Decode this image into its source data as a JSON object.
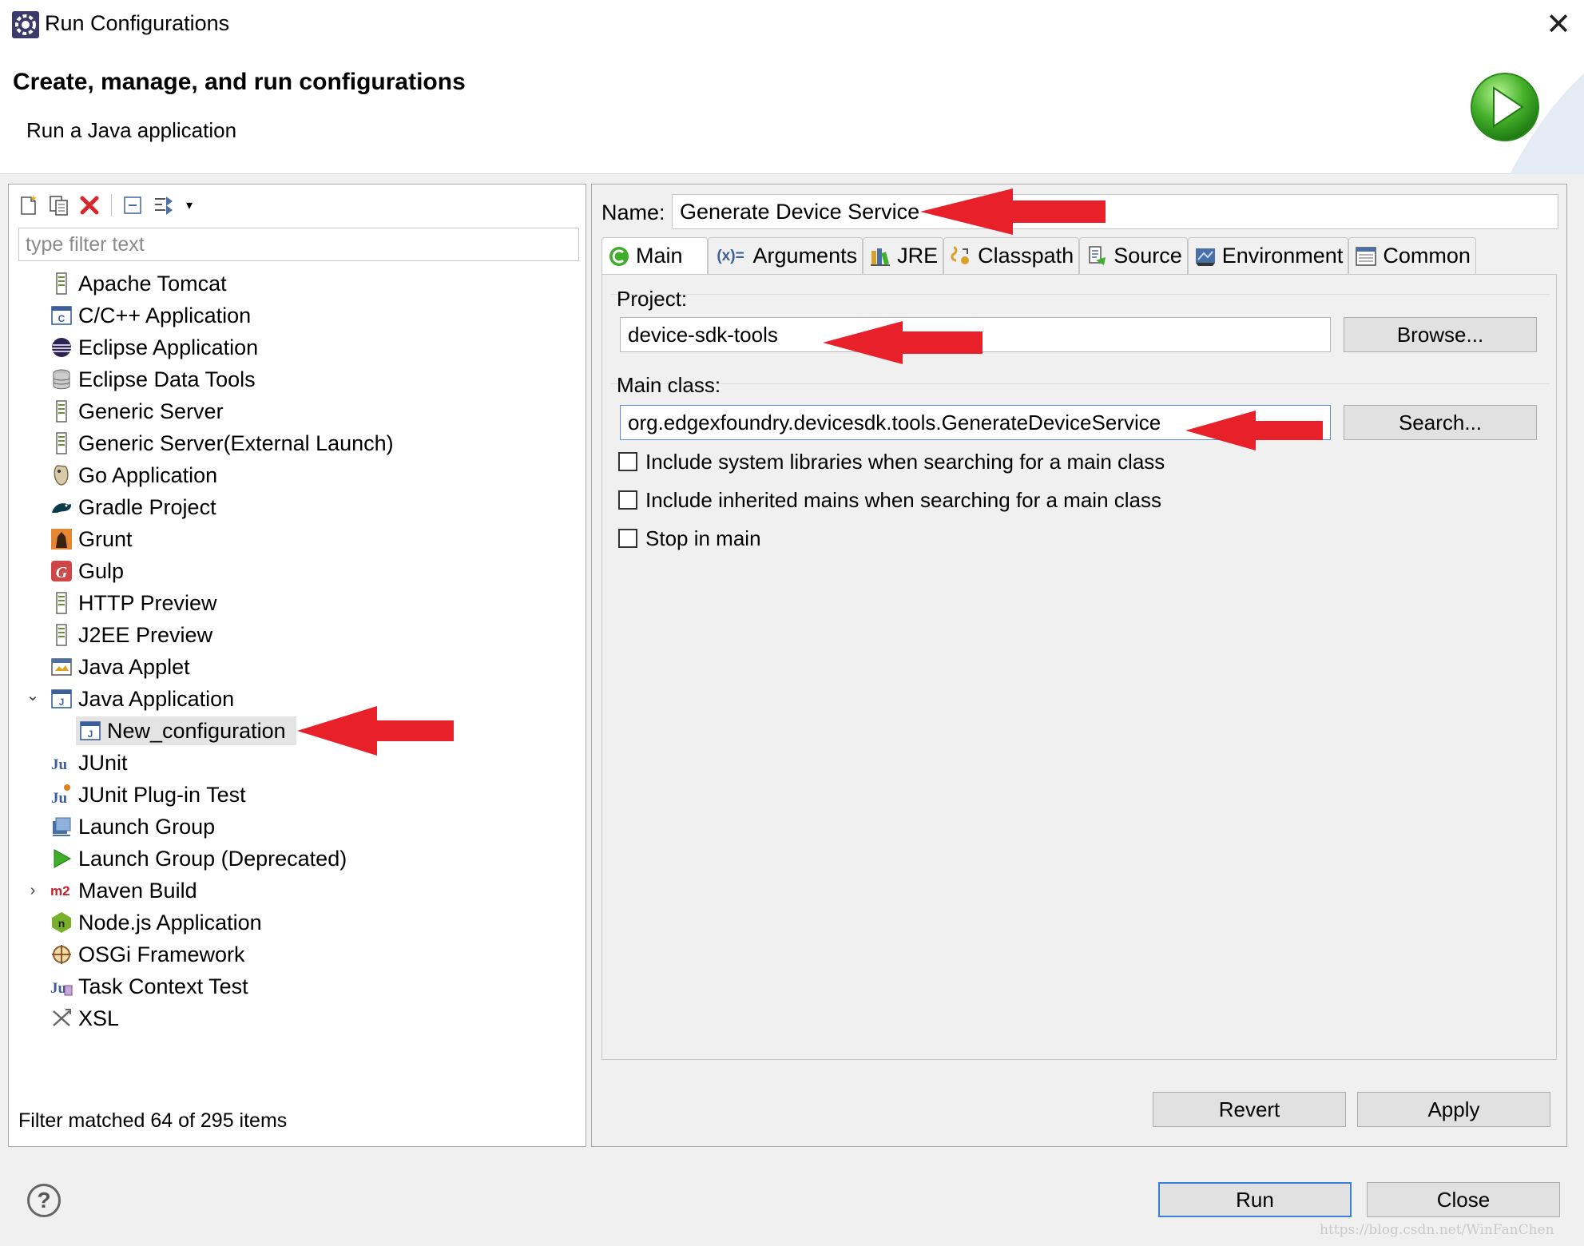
{
  "window": {
    "title": "Run Configurations",
    "close_glyph": "✕"
  },
  "banner": {
    "heading": "Create, manage, and run configurations",
    "subheading": "Run a Java application"
  },
  "left": {
    "toolbar": {
      "icons": [
        "new-launch-configuration-icon",
        "duplicate-icon",
        "delete-icon",
        "collapse-all-icon",
        "filter-icon",
        "dropdown-icon"
      ],
      "dropdown_glyph": "▾"
    },
    "filter_placeholder": "type filter text",
    "tree": [
      {
        "label": "Apache Tomcat",
        "icon": "server-icon"
      },
      {
        "label": "C/C++ Application",
        "icon": "c-app-icon"
      },
      {
        "label": "Eclipse Application",
        "icon": "eclipse-icon"
      },
      {
        "label": "Eclipse Data Tools",
        "icon": "database-icon"
      },
      {
        "label": "Generic Server",
        "icon": "server-icon"
      },
      {
        "label": "Generic Server(External Launch)",
        "icon": "server-icon"
      },
      {
        "label": "Go Application",
        "icon": "go-icon"
      },
      {
        "label": "Gradle Project",
        "icon": "gradle-icon"
      },
      {
        "label": "Grunt",
        "icon": "grunt-icon"
      },
      {
        "label": "Gulp",
        "icon": "gulp-icon"
      },
      {
        "label": "HTTP Preview",
        "icon": "server-icon"
      },
      {
        "label": "J2EE Preview",
        "icon": "server-icon"
      },
      {
        "label": "Java Applet",
        "icon": "applet-icon"
      },
      {
        "label": "Java Application",
        "icon": "java-app-icon"
      },
      {
        "label": "New_configuration",
        "icon": "java-app-icon"
      },
      {
        "label": "JUnit",
        "icon": "junit-icon"
      },
      {
        "label": "JUnit Plug-in Test",
        "icon": "junit-plugin-icon"
      },
      {
        "label": "Launch Group",
        "icon": "launch-group-icon"
      },
      {
        "label": "Launch Group (Deprecated)",
        "icon": "play-icon"
      },
      {
        "label": "Maven Build",
        "icon": "maven-icon"
      },
      {
        "label": "Node.js Application",
        "icon": "nodejs-icon"
      },
      {
        "label": "OSGi Framework",
        "icon": "osgi-icon"
      },
      {
        "label": "Task Context Test",
        "icon": "task-test-icon"
      },
      {
        "label": "XSL",
        "icon": "xsl-icon"
      }
    ],
    "expanded_glyph": "⌄",
    "collapsed_glyph": "›",
    "maven_text": "m2",
    "gulp_text": "G",
    "node_text": "n",
    "junit_text": "Ju",
    "filter_status": "Filter matched 64 of 295 items"
  },
  "right": {
    "name_label": "Name:",
    "name_value": "Generate Device Service",
    "tabs": [
      {
        "label": "Main",
        "icon": "main-tab-icon"
      },
      {
        "label": "Arguments",
        "icon": "arguments-icon"
      },
      {
        "label": "JRE",
        "icon": "jre-icon"
      },
      {
        "label": "Classpath",
        "icon": "classpath-icon"
      },
      {
        "label": "Source",
        "icon": "source-icon"
      },
      {
        "label": "Environment",
        "icon": "environment-icon"
      },
      {
        "label": "Common",
        "icon": "common-icon"
      }
    ],
    "arguments_glyph": "(x)=",
    "project_label": "Project:",
    "project_value": "device-sdk-tools",
    "browse_label": "Browse...",
    "main_class_label": "Main class:",
    "main_class_value": "org.edgexfoundry.devicesdk.tools.GenerateDeviceService",
    "search_label": "Search...",
    "checkboxes": [
      {
        "label": "Include system libraries when searching for a main class",
        "checked": false
      },
      {
        "label": "Include inherited mains when searching for a main class",
        "checked": false
      },
      {
        "label": "Stop in main",
        "checked": false
      }
    ],
    "revert_label": "Revert",
    "apply_label": "Apply"
  },
  "footer": {
    "help_glyph": "?",
    "run_label": "Run",
    "close_label": "Close",
    "watermark": "https://blog.csdn.net/WinFanChen"
  },
  "colors": {
    "annotation_arrow": "#e8202a",
    "default_button_border": "#3c7fd6",
    "run_green": "#3fae2a"
  }
}
